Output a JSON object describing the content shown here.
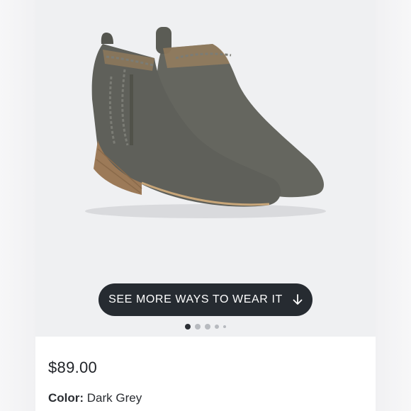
{
  "carousel": {
    "cta_label": "SEE MORE WAYS TO WEAR IT",
    "cta_icon": "arrow-down-icon",
    "active_slide": 1,
    "slide_count": 5
  },
  "product": {
    "price": "$89.00",
    "color_label": "Color:",
    "color_value": "Dark Grey",
    "image_description": "grey suede wedge ankle booties"
  },
  "colors": {
    "image_background": "#eff0f2",
    "cta_background": "#262b31",
    "suede": "#5d5e58",
    "wood": "#9c7a58"
  }
}
